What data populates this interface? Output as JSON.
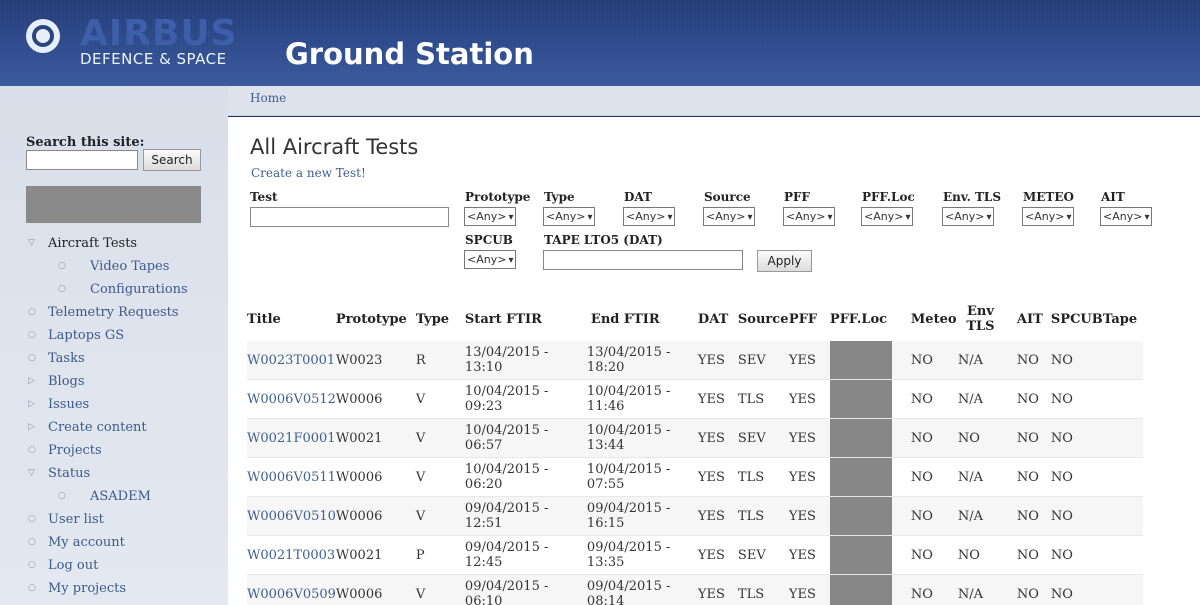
{
  "header": {
    "brand_name": "AIRBUS",
    "brand_sub": "DEFENCE & SPACE",
    "site_name": "Ground Station"
  },
  "breadcrumb": {
    "home": "Home"
  },
  "sidebar": {
    "search_label": "Search this site:",
    "search_button": "Search",
    "search_value": "",
    "items": [
      {
        "label": "Aircraft Tests",
        "bullet": "▽"
      },
      {
        "label": "Video Tapes",
        "bullet": "○"
      },
      {
        "label": "Configurations",
        "bullet": "○"
      },
      {
        "label": "Telemetry Requests",
        "bullet": "○"
      },
      {
        "label": "Laptops GS",
        "bullet": "○"
      },
      {
        "label": "Tasks",
        "bullet": "○"
      },
      {
        "label": "Blogs",
        "bullet": "▷"
      },
      {
        "label": "Issues",
        "bullet": "▷"
      },
      {
        "label": "Create content",
        "bullet": "▷"
      },
      {
        "label": "Projects",
        "bullet": "○"
      },
      {
        "label": "Status",
        "bullet": "▽"
      },
      {
        "label": "ASADEM",
        "bullet": "○"
      },
      {
        "label": "User list",
        "bullet": "○"
      },
      {
        "label": "My account",
        "bullet": "○"
      },
      {
        "label": "Log out",
        "bullet": "○"
      },
      {
        "label": "My projects",
        "bullet": "○"
      }
    ]
  },
  "main": {
    "title": "All Aircraft Tests",
    "create_link": "Create a new Test!",
    "filters": {
      "test_label": "Test",
      "test_value": "",
      "selects": [
        {
          "label": "Prototype",
          "value": "<Any>"
        },
        {
          "label": "Type",
          "value": "<Any>"
        },
        {
          "label": "DAT",
          "value": "<Any>"
        },
        {
          "label": "Source",
          "value": "<Any>"
        },
        {
          "label": "PFF",
          "value": "<Any>"
        },
        {
          "label": "PFF.Loc",
          "value": "<Any>"
        },
        {
          "label": "Env. TLS",
          "value": "<Any>"
        },
        {
          "label": "METEO",
          "value": "<Any>"
        },
        {
          "label": "AIT",
          "value": "<Any>"
        },
        {
          "label": "SPCUB",
          "value": "<Any>"
        }
      ],
      "tape_label": "TAPE LTO5 (DAT)",
      "tape_value": "",
      "apply": "Apply"
    },
    "table": {
      "headers": [
        "Title",
        "Prototype",
        "Type",
        "Start FTIR",
        "End FTIR",
        "DAT",
        "Source",
        "PFF",
        "PFF.Loc",
        "Meteo",
        "Env TLS",
        "AIT",
        "SPCUB",
        "Tape"
      ],
      "rows": [
        {
          "title": "W0023T0001",
          "prototype": "W0023",
          "type": "R",
          "start": "13/04/2015 - 13:10",
          "end1": "13/04/2015 -",
          "end2": "18:20",
          "dat": "YES",
          "source": "SEV",
          "pff": "YES",
          "meteo": "NO",
          "env": "N/A",
          "ait": "NO",
          "spcub": "NO"
        },
        {
          "title": "W0006V0512",
          "prototype": "W0006",
          "type": "V",
          "start": "10/04/2015 - 09:23",
          "end1": "10/04/2015 -",
          "end2": "11:46",
          "dat": "YES",
          "source": "TLS",
          "pff": "YES",
          "meteo": "NO",
          "env": "N/A",
          "ait": "NO",
          "spcub": "NO"
        },
        {
          "title": "W0021F0001",
          "prototype": "W0021",
          "type": "V",
          "start": "10/04/2015 - 06:57",
          "end1": "10/04/2015 -",
          "end2": "13:44",
          "dat": "YES",
          "source": "SEV",
          "pff": "YES",
          "meteo": "NO",
          "env": "NO",
          "ait": "NO",
          "spcub": "NO"
        },
        {
          "title": "W0006V0511",
          "prototype": "W0006",
          "type": "V",
          "start": "10/04/2015 - 06:20",
          "end1": "10/04/2015 -",
          "end2": "07:55",
          "dat": "YES",
          "source": "TLS",
          "pff": "YES",
          "meteo": "NO",
          "env": "N/A",
          "ait": "NO",
          "spcub": "NO"
        },
        {
          "title": "W0006V0510",
          "prototype": "W0006",
          "type": "V",
          "start": "09/04/2015 - 12:51",
          "end1": "09/04/2015 -",
          "end2": "16:15",
          "dat": "YES",
          "source": "TLS",
          "pff": "YES",
          "meteo": "NO",
          "env": "N/A",
          "ait": "NO",
          "spcub": "NO"
        },
        {
          "title": "W0021T0003",
          "prototype": "W0021",
          "type": "P",
          "start": "09/04/2015 - 12:45",
          "end1": "09/04/2015 -",
          "end2": "13:35",
          "dat": "YES",
          "source": "SEV",
          "pff": "YES",
          "meteo": "NO",
          "env": "NO",
          "ait": "NO",
          "spcub": "NO"
        },
        {
          "title": "W0006V0509",
          "prototype": "W0006",
          "type": "V",
          "start": "09/04/2015 - 06:10",
          "end1": "09/04/2015 -",
          "end2": "08:14",
          "dat": "YES",
          "source": "TLS",
          "pff": "YES",
          "meteo": "NO",
          "env": "N/A",
          "ait": "NO",
          "spcub": "NO"
        }
      ]
    }
  },
  "colors": {
    "header": "#2f4c8e",
    "link": "#3f5f8f",
    "redacted": "#878787"
  }
}
